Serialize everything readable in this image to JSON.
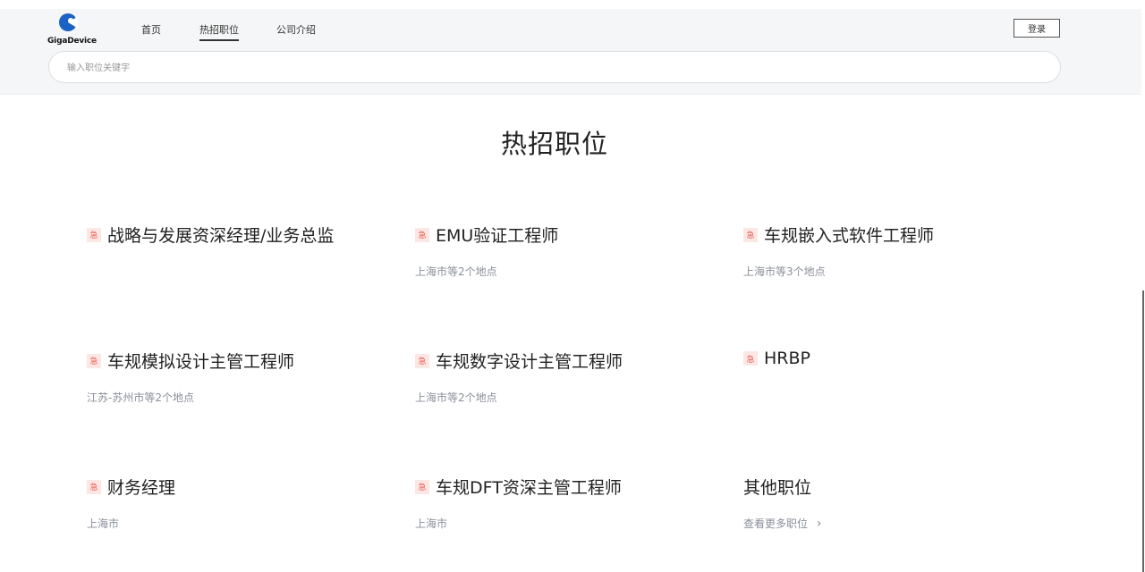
{
  "logo": {
    "text": "GigaDevice",
    "brand_color": "#1a62c4"
  },
  "nav": {
    "items": [
      {
        "label": "首页",
        "active": false
      },
      {
        "label": "热招职位",
        "active": true
      },
      {
        "label": "公司介绍",
        "active": false
      }
    ],
    "login_label": "登录"
  },
  "search": {
    "placeholder": "输入职位关键字",
    "value": ""
  },
  "page_title": "热招职位",
  "urgent_badge": "急",
  "jobs": [
    {
      "title": "战略与发展资深经理/业务总监",
      "location": "",
      "urgent": true
    },
    {
      "title": "EMU验证工程师",
      "location": "上海市等2个地点",
      "urgent": true
    },
    {
      "title": "车规嵌入式软件工程师",
      "location": "上海市等3个地点",
      "urgent": true
    },
    {
      "title": "车规模拟设计主管工程师",
      "location": "江苏-苏州市等2个地点",
      "urgent": true
    },
    {
      "title": "车规数字设计主管工程师",
      "location": "上海市等2个地点",
      "urgent": true
    },
    {
      "title": "HRBP",
      "location": "",
      "urgent": true
    },
    {
      "title": "财务经理",
      "location": "上海市",
      "urgent": true
    },
    {
      "title": "车规DFT资深主管工程师",
      "location": "上海市",
      "urgent": true
    }
  ],
  "other_jobs": {
    "title": "其他职位",
    "link_label": "查看更多职位",
    "chevron": "›"
  },
  "colors": {
    "urgent_bg": "#fde7e4",
    "urgent_fg": "#e85a4f",
    "header_bg": "#f5f6f7"
  }
}
